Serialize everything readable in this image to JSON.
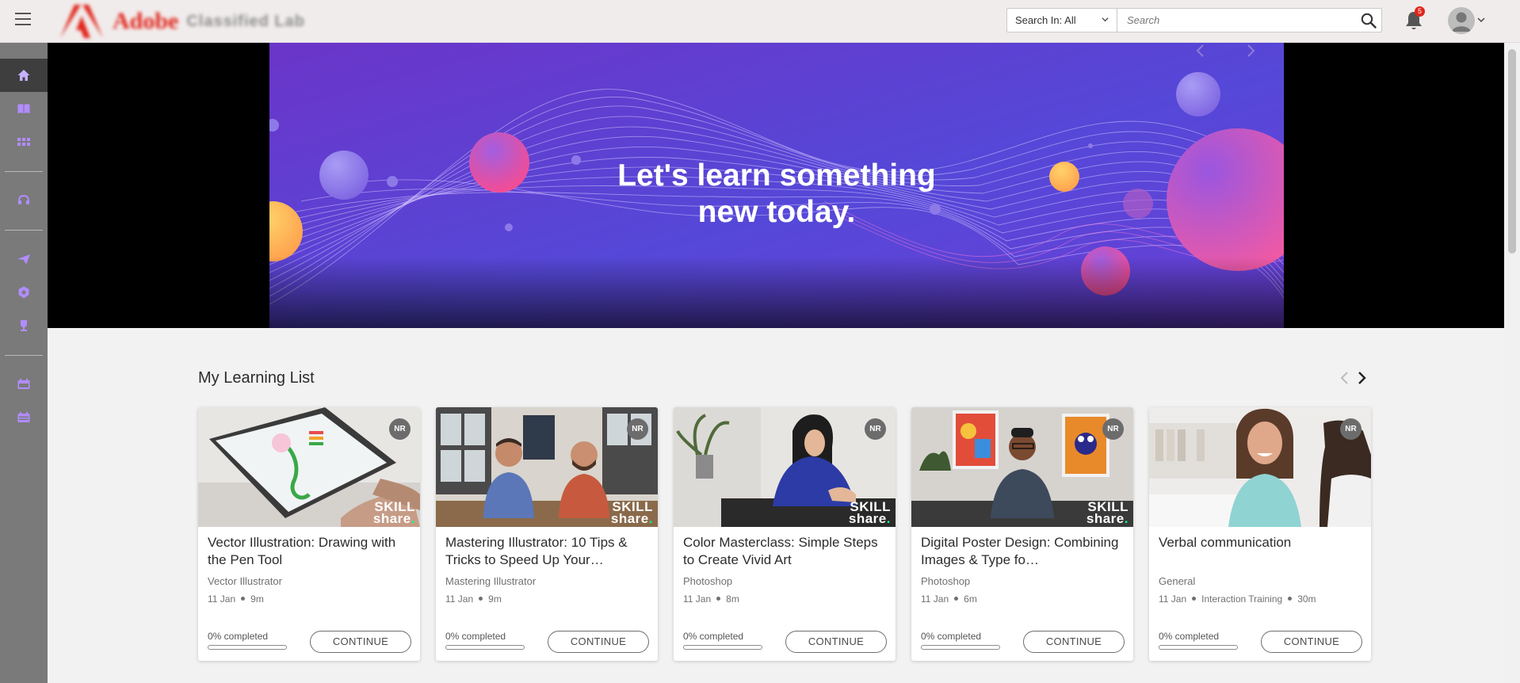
{
  "header": {
    "brand_name": "Adobe",
    "brand_sub": "Classified Lab",
    "search_scope": "Search In: All",
    "search_placeholder": "Search",
    "notification_count": "5"
  },
  "sidebar": {
    "items": [
      {
        "icon": "home-icon",
        "active": true
      },
      {
        "icon": "book-icon"
      },
      {
        "icon": "catalog-grid-icon"
      },
      {
        "icon": "headset-support-icon"
      },
      {
        "icon": "send-icon"
      },
      {
        "icon": "shield-badge-icon"
      },
      {
        "icon": "trophy-icon"
      },
      {
        "icon": "calendar-sessions-icon"
      },
      {
        "icon": "calendar-events-icon"
      }
    ]
  },
  "hero": {
    "headline_line1": "Let's learn something",
    "headline_line2": "new today."
  },
  "learning_list": {
    "title": "My Learning List",
    "cards": [
      {
        "title": "Vector Illustration: Drawing with the Pen Tool",
        "category": "Vector Illustrator",
        "date": "11 Jan",
        "duration": "9m",
        "progress_label": "0% completed",
        "progress": 0,
        "button": "CONTINUE",
        "badge": "NR",
        "provider_line1": "SKILL",
        "provider_line2": "share",
        "provider_dot": "."
      },
      {
        "title": "Mastering Illustrator: 10 Tips & Tricks to Speed Up Your…",
        "category": "Mastering Illustrator",
        "date": "11 Jan",
        "duration": "9m",
        "progress_label": "0% completed",
        "progress": 0,
        "button": "CONTINUE",
        "badge": "NR",
        "provider_line1": "SKILL",
        "provider_line2": "share",
        "provider_dot": "."
      },
      {
        "title": "Color Masterclass: Simple Steps to Create Vivid Art",
        "category": "Photoshop",
        "date": "11 Jan",
        "duration": "8m",
        "progress_label": "0% completed",
        "progress": 0,
        "button": "CONTINUE",
        "badge": "NR",
        "provider_line1": "SKILL",
        "provider_line2": "share",
        "provider_dot": "."
      },
      {
        "title": "Digital Poster Design: Combining Images & Type fo…",
        "category": "Photoshop",
        "date": "11 Jan",
        "duration": "6m",
        "progress_label": "0% completed",
        "progress": 0,
        "button": "CONTINUE",
        "badge": "NR",
        "provider_line1": "SKILL",
        "provider_line2": "share",
        "provider_dot": "."
      },
      {
        "title": "Verbal communication",
        "category": "General",
        "date": "11 Jan",
        "extra": "Interaction Training",
        "duration": "30m",
        "progress_label": "0% completed",
        "progress": 0,
        "button": "CONTINUE",
        "badge": "NR"
      }
    ]
  },
  "colors": {
    "accent_purple": "#8a5cf6",
    "sidebar_bg": "#7a7a7a",
    "hero_bg": "#5b3fd6",
    "notification_red": "#e1251b"
  }
}
